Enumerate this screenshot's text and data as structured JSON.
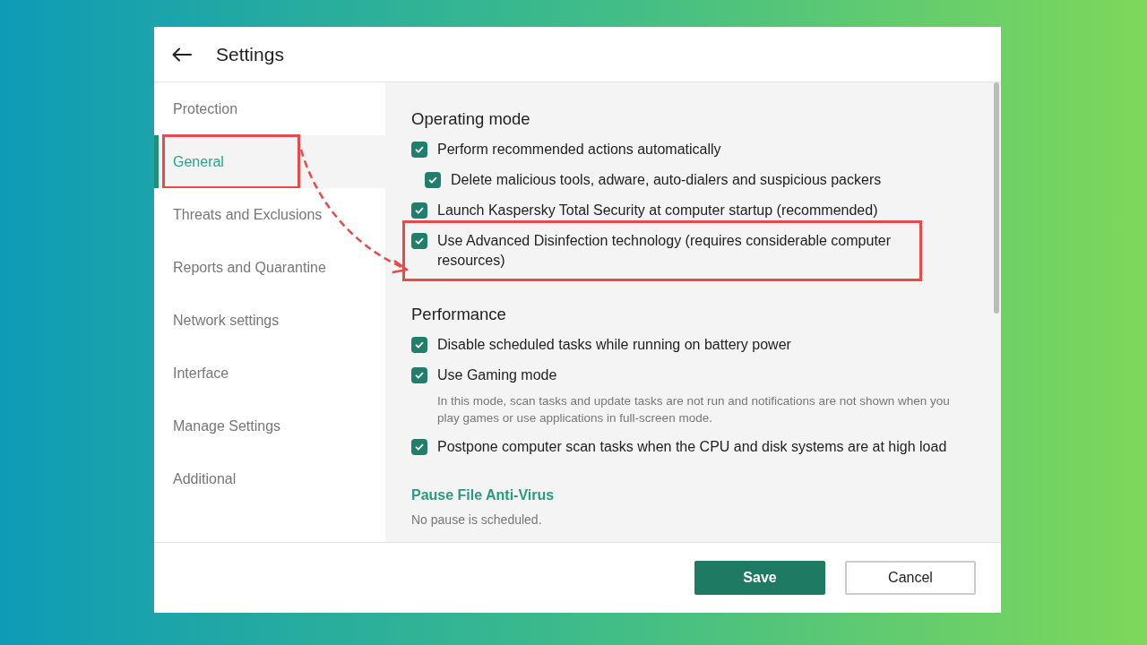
{
  "window": {
    "title": "Settings"
  },
  "sidebar": {
    "items": [
      {
        "label": "Protection",
        "selected": false,
        "highlighted": false
      },
      {
        "label": "General",
        "selected": true,
        "highlighted": true
      },
      {
        "label": "Threats and Exclusions",
        "selected": false,
        "highlighted": false
      },
      {
        "label": "Reports and Quarantine",
        "selected": false,
        "highlighted": false
      },
      {
        "label": "Network settings",
        "selected": false,
        "highlighted": false
      },
      {
        "label": "Interface",
        "selected": false,
        "highlighted": false
      },
      {
        "label": "Manage Settings",
        "selected": false,
        "highlighted": false
      },
      {
        "label": "Additional",
        "selected": false,
        "highlighted": false
      }
    ]
  },
  "sections": [
    {
      "kind": "options",
      "heading": "Operating mode",
      "options": [
        {
          "label": "Perform recommended actions automatically",
          "checked": true,
          "highlighted": false,
          "children": [
            {
              "label": "Delete malicious tools, adware, auto-dialers and suspicious packers",
              "checked": true,
              "highlighted": false
            }
          ]
        },
        {
          "label": "Launch Kaspersky Total Security at computer startup (recommended)",
          "checked": true,
          "highlighted": false
        },
        {
          "label": "Use Advanced Disinfection technology (requires considerable computer resources)",
          "checked": true,
          "highlighted": true
        }
      ]
    },
    {
      "kind": "options",
      "heading": "Performance",
      "options": [
        {
          "label": "Disable scheduled tasks while running on battery power",
          "checked": true,
          "highlighted": false
        },
        {
          "label": "Use Gaming mode",
          "checked": true,
          "highlighted": false,
          "description": "In this mode, scan tasks and update tasks are not run and notifications are not shown when you play games or use applications in full-screen mode."
        },
        {
          "label": "Postpone computer scan tasks when the CPU and disk systems are at high load",
          "checked": true,
          "highlighted": false
        }
      ]
    },
    {
      "kind": "link",
      "heading": "Pause File Anti-Virus",
      "text": "No pause is scheduled."
    }
  ],
  "buttons": [
    {
      "label": "Save",
      "kind": "primary"
    },
    {
      "label": "Cancel",
      "kind": "secondary"
    }
  ]
}
